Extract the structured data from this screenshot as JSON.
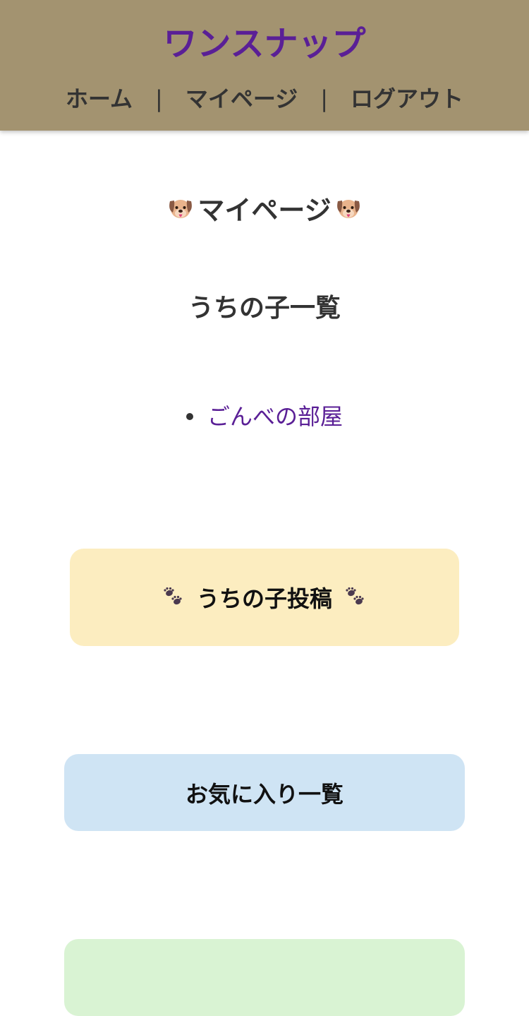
{
  "header": {
    "site_title": "ワンスナップ",
    "nav": {
      "home": "ホーム",
      "separator": "|",
      "mypage": "マイページ",
      "logout": "ログアウト"
    }
  },
  "main": {
    "page_title": "マイページ",
    "page_title_icon": "dog-face-icon",
    "section_title": "うちの子一覧",
    "pets": [
      {
        "name": "ごんべの部屋"
      }
    ],
    "buttons": {
      "post": "うちの子投稿",
      "post_icon": "paw-prints-icon",
      "favorites": "お気に入り一覧"
    }
  },
  "colors": {
    "header_bg": "#a39370",
    "brand": "#5a1f96",
    "post_button_bg": "#fcedc0",
    "favorites_button_bg": "#cfe4f4",
    "next_button_bg": "#d9f3d3"
  }
}
